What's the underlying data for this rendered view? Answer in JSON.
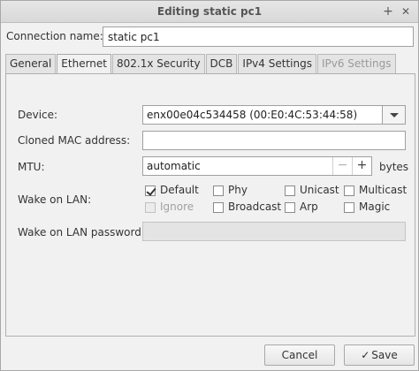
{
  "window": {
    "title": "Editing static pc1",
    "add_icon": "+",
    "close_icon": "✕"
  },
  "connection": {
    "label": "Connection name:",
    "value": "static pc1"
  },
  "tabs": [
    {
      "label": "General",
      "active": false,
      "disabled": false
    },
    {
      "label": "Ethernet",
      "active": true,
      "disabled": false
    },
    {
      "label": "802.1x Security",
      "active": false,
      "disabled": false
    },
    {
      "label": "DCB",
      "active": false,
      "disabled": false
    },
    {
      "label": "IPv4 Settings",
      "active": false,
      "disabled": false
    },
    {
      "label": "IPv6 Settings",
      "active": false,
      "disabled": true
    }
  ],
  "ethernet": {
    "device_label": "Device:",
    "device_value": "enx00e04c534458 (00:E0:4C:53:44:58)",
    "cloned_mac_label": "Cloned MAC address:",
    "cloned_mac_value": "",
    "mtu_label": "MTU:",
    "mtu_value": "automatic",
    "mtu_unit": "bytes",
    "mtu_minus": "−",
    "mtu_plus": "+",
    "wol_label": "Wake on LAN:",
    "wol_options": [
      {
        "label": "Default",
        "checked": true,
        "disabled": false
      },
      {
        "label": "Phy",
        "checked": false,
        "disabled": false
      },
      {
        "label": "Unicast",
        "checked": false,
        "disabled": false
      },
      {
        "label": "Multicast",
        "checked": false,
        "disabled": false
      },
      {
        "label": "Ignore",
        "checked": false,
        "disabled": true
      },
      {
        "label": "Broadcast",
        "checked": false,
        "disabled": false
      },
      {
        "label": "Arp",
        "checked": false,
        "disabled": false
      },
      {
        "label": "Magic",
        "checked": false,
        "disabled": false
      }
    ],
    "wol_password_label": "Wake on LAN password:",
    "wol_password_value": ""
  },
  "buttons": {
    "cancel": "Cancel",
    "save": "Save",
    "save_icon": "✓"
  }
}
